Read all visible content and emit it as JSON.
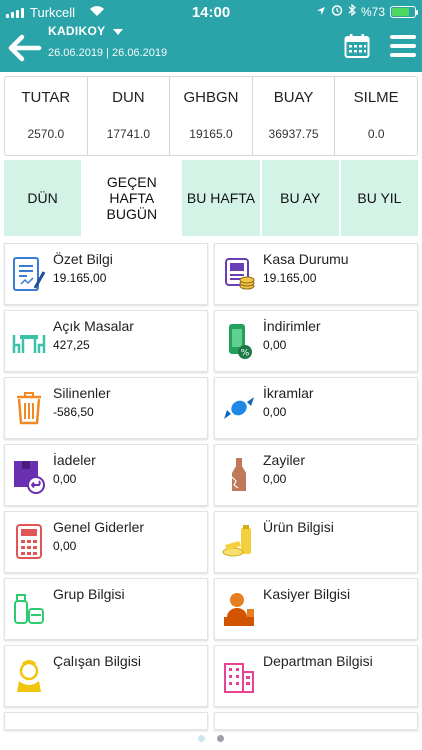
{
  "status_bar": {
    "carrier": "Turkcell",
    "time": "14:00",
    "battery": "%73"
  },
  "header": {
    "branch": "KADIKOY",
    "date_range": "26.06.2019 | 26.06.2019"
  },
  "summary": [
    {
      "label": "TUTAR",
      "value": "2570.0"
    },
    {
      "label": "DUN",
      "value": "17741.0"
    },
    {
      "label": "GHBGN",
      "value": "19165.0"
    },
    {
      "label": "BUAY",
      "value": "36937.75"
    },
    {
      "label": "SILME",
      "value": "0.0"
    }
  ],
  "tabs": [
    {
      "label": "DÜN"
    },
    {
      "label": "GEÇEN HAFTA BUGÜN"
    },
    {
      "label": "BU HAFTA"
    },
    {
      "label": "BU AY"
    },
    {
      "label": "BU YIL"
    }
  ],
  "cards": [
    {
      "title": "Özet Bilgi",
      "value": "19.165,00",
      "icon": "report-icon"
    },
    {
      "title": "Kasa Durumu",
      "value": "19.165,00",
      "icon": "cash-register-icon"
    },
    {
      "title": "Açık Masalar",
      "value": "427,25",
      "icon": "tables-icon"
    },
    {
      "title": "İndirimler",
      "value": "0,00",
      "icon": "discount-phone-icon"
    },
    {
      "title": "Silinenler",
      "value": "-586,50",
      "icon": "trash-icon"
    },
    {
      "title": "İkramlar",
      "value": "0,00",
      "icon": "candy-icon"
    },
    {
      "title": "İadeler",
      "value": "0,00",
      "icon": "return-box-icon"
    },
    {
      "title": "Zayiler",
      "value": "0,00",
      "icon": "bottle-icon"
    },
    {
      "title": "Genel Giderler",
      "value": "0,00",
      "icon": "calculator-icon"
    },
    {
      "title": "Ürün Bilgisi",
      "value": "",
      "icon": "products-icon"
    },
    {
      "title": "Grup Bilgisi",
      "value": "",
      "icon": "groceries-icon"
    },
    {
      "title": "Kasiyer Bilgisi",
      "value": "",
      "icon": "cashier-icon"
    },
    {
      "title": "Çalışan Bilgisi",
      "value": "",
      "icon": "employee-icon"
    },
    {
      "title": "Departman Bilgisi",
      "value": "",
      "icon": "building-icon"
    }
  ],
  "colors": {
    "header": "#2aa4a9",
    "tab_bg": "#d4f3e7"
  }
}
